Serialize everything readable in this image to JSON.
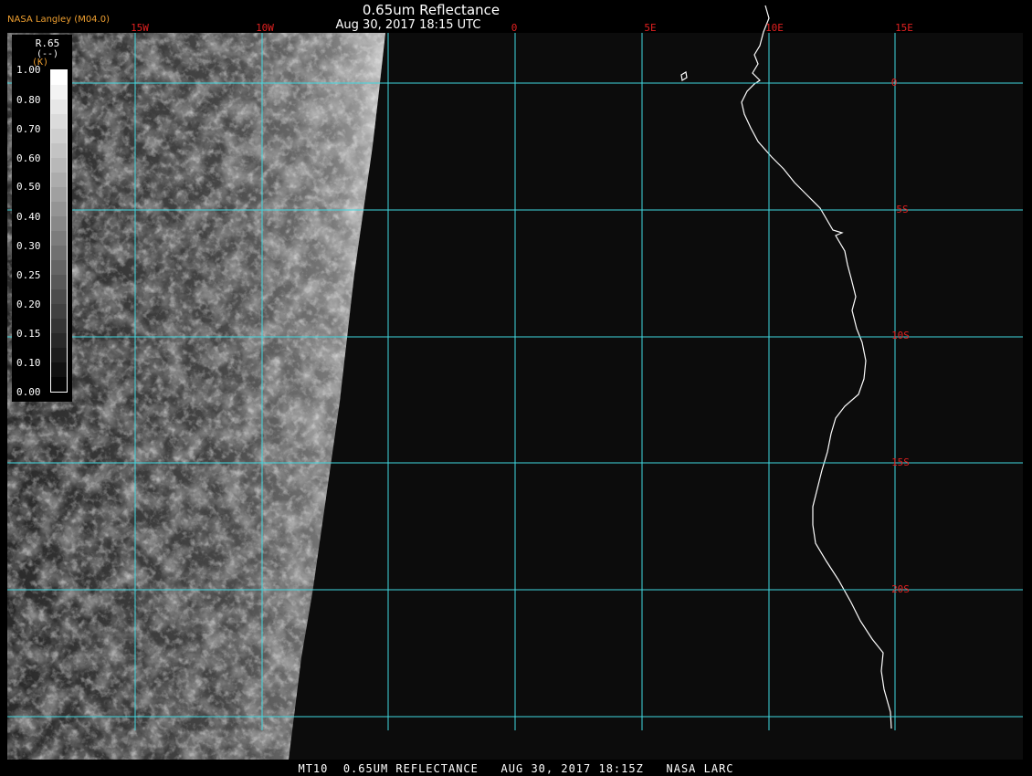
{
  "header": {
    "title": "0.65um Reflectance",
    "datetime": "Aug 30, 2017 18:15 UTC",
    "credit": "NASA Langley (M04.0)"
  },
  "footer": {
    "text": "MT10  0.65UM REFLECTANCE   AUG 30, 2017 18:15Z   NASA LARC"
  },
  "legend": {
    "title": "R.65",
    "units": "(--)",
    "mark": "(K)",
    "ticks": [
      "1.00",
      "0.80",
      "0.70",
      "0.60",
      "0.50",
      "0.40",
      "0.30",
      "0.25",
      "0.20",
      "0.15",
      "0.10",
      "0.00"
    ]
  },
  "map": {
    "longitude_labels": [
      "15W",
      "10W",
      "0",
      "5E",
      "10E",
      "15E"
    ],
    "latitude_labels": [
      "0",
      "5S",
      "10S",
      "15S",
      "20S"
    ],
    "grid_color": "#40d8e0",
    "lon_label_color": "#e02020",
    "lat_label_color": "#e02020",
    "background_color": "#0c0c0c"
  }
}
